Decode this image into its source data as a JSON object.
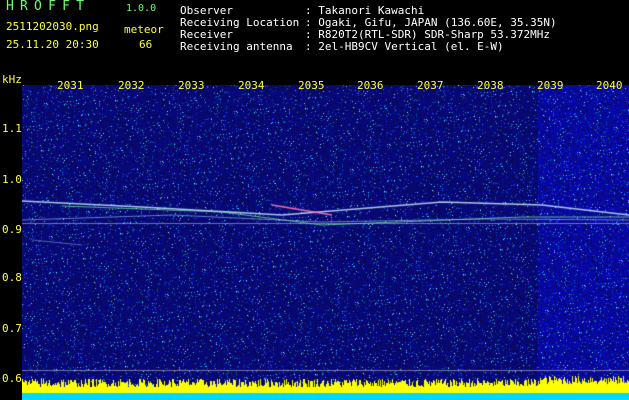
{
  "header": {
    "title": "HROFFT",
    "version": "1.0.0",
    "filename": "2511202030.png",
    "meteor_label": "meteor",
    "timestamp": "25.11.20 20:30",
    "meteor_count": "66"
  },
  "info": [
    {
      "key": "Observer",
      "value": ": Takanori Kawachi"
    },
    {
      "key": "Receiving Location",
      "value": ": Ogaki, Gifu, JAPAN (136.60E, 35.35N)"
    },
    {
      "key": "Receiver",
      "value": ": R820T2(RTL-SDR) SDR-Sharp 53.372MHz"
    },
    {
      "key": "Receiving antenna",
      "value": ": 2el-HB9CV Vertical (el. E-W)"
    }
  ],
  "axis": {
    "unit": "kHz",
    "y_ticks": [
      "1.1",
      "1.0",
      "0.9",
      "0.8",
      "0.7",
      "0.6"
    ],
    "x_ticks": [
      "2031",
      "2032",
      "2033",
      "2034",
      "2035",
      "2036",
      "2037",
      "2038",
      "2039",
      "2040"
    ]
  },
  "colors": {
    "background": "#000000",
    "label_green": "#6cff6c",
    "label_yellow": "#ffff3c",
    "noise_base": "#10108c",
    "signal_line": "#c8e6ff",
    "level_bar": "#ffff00",
    "bottom_band": "#00d8ff"
  }
}
